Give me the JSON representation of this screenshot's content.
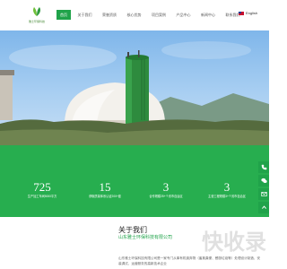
{
  "brand": {
    "logo_text": "雅士环保科技"
  },
  "nav": {
    "items": [
      "首页",
      "关于我们",
      "荣誉资质",
      "核心优势",
      "项目案例",
      "产品中心",
      "新闻中心",
      "联系我们"
    ],
    "active_index": 0
  },
  "lang": {
    "label": "English"
  },
  "stats": [
    {
      "value": "725",
      "label": "生产加工车间5000平方"
    },
    {
      "value": "15",
      "label": "获取质量体系认证200+套"
    },
    {
      "value": "3",
      "label": "合作规模25+个省市自治区"
    },
    {
      "value": "3",
      "label": "主营工程规模3+个省市自治区"
    }
  ],
  "about": {
    "title": "关于我们",
    "subtitle": "山东雅士环保科技有限公司",
    "text": "山东雅士环保科技有限公司是一家专门从事有机废弃物（畜禽粪便、餐厨垃圾等）处理设计制造、安装调试、运营服务的高新技术企业"
  },
  "watermark": "快收录",
  "colors": {
    "brand_green": "#27ae4f",
    "nav_active": "#20a34a"
  },
  "icons": [
    "phone-icon",
    "wechat-icon",
    "message-icon",
    "back-to-top-icon"
  ]
}
